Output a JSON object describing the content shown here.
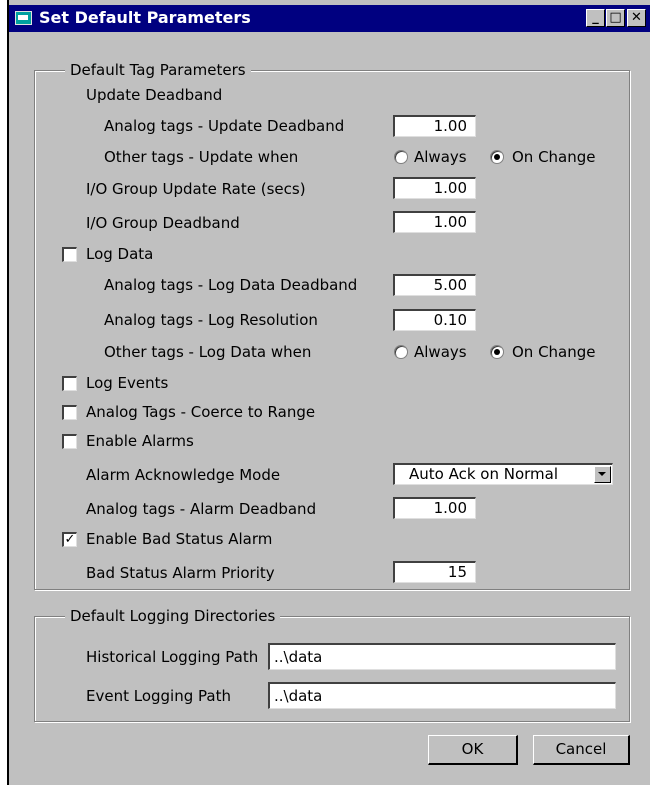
{
  "window": {
    "title": "Set Default Parameters",
    "minimize": "_",
    "maximize": "□",
    "close": "✕"
  },
  "tag_params": {
    "legend": "Default Tag Parameters",
    "update_deadband_header": "Update Deadband",
    "analog_update_deadband": {
      "label": "Analog tags - Update Deadband",
      "value": "1.00"
    },
    "other_update_when": {
      "label": "Other tags - Update when",
      "always": "Always",
      "on_change": "On Change",
      "selected": "On Change"
    },
    "io_update_rate": {
      "label": "I/O Group Update Rate (secs)",
      "value": "1.00"
    },
    "io_deadband": {
      "label": "I/O Group Deadband",
      "value": "1.00"
    },
    "log_data": {
      "label": "Log Data",
      "checked": false
    },
    "log_data_deadband": {
      "label": "Analog tags - Log Data Deadband",
      "value": "5.00"
    },
    "log_resolution": {
      "label": "Analog tags - Log Resolution",
      "value": "0.10"
    },
    "other_log_when": {
      "label": "Other tags - Log Data when",
      "always": "Always",
      "on_change": "On Change",
      "selected": "On Change"
    },
    "log_events": {
      "label": "Log Events",
      "checked": false
    },
    "coerce": {
      "label": "Analog Tags - Coerce to Range",
      "checked": false
    },
    "enable_alarms": {
      "label": "Enable Alarms",
      "checked": false
    },
    "ack_mode": {
      "label": "Alarm Acknowledge Mode",
      "value": "Auto Ack on Normal"
    },
    "alarm_deadband": {
      "label": "Analog tags - Alarm Deadband",
      "value": "1.00"
    },
    "bad_status_alarm": {
      "label": "Enable Bad Status Alarm",
      "checked": true,
      "mark": "✓"
    },
    "bad_status_priority": {
      "label": "Bad Status Alarm Priority",
      "value": "15"
    }
  },
  "logging_dirs": {
    "legend": "Default Logging Directories",
    "historical": {
      "label": "Historical Logging Path",
      "value": "..\\data"
    },
    "event": {
      "label": "Event Logging Path",
      "value": "..\\data"
    }
  },
  "buttons": {
    "ok": "OK",
    "cancel": "Cancel"
  }
}
